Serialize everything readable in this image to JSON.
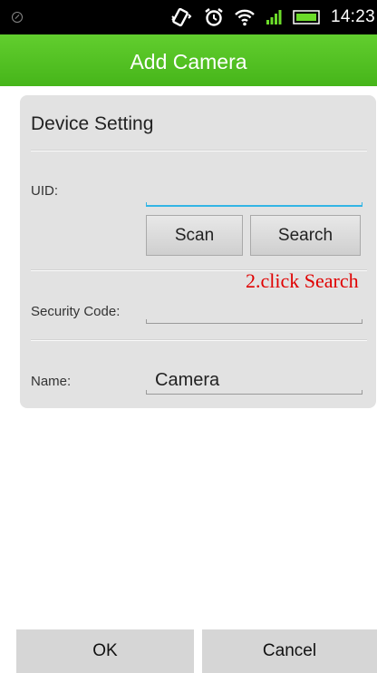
{
  "status_bar": {
    "time": "14:23",
    "icons": [
      "blocked-circle-icon",
      "vibrate-icon",
      "alarm-icon",
      "wifi-icon",
      "signal-icon",
      "battery-icon"
    ]
  },
  "header": {
    "title": "Add Camera"
  },
  "card": {
    "title": "Device Setting",
    "uid": {
      "label": "UID:",
      "value": ""
    },
    "scan_label": "Scan",
    "search_label": "Search",
    "security": {
      "label": "Security Code:",
      "value": ""
    },
    "name": {
      "label": "Name:",
      "value": "Camera"
    }
  },
  "annotation": "2.click Search",
  "footer": {
    "ok_label": "OK",
    "cancel_label": "Cancel"
  },
  "colors": {
    "header_green": "#4cbb1f",
    "focus_blue": "#33b5e5",
    "annotation_red": "#e00000"
  }
}
